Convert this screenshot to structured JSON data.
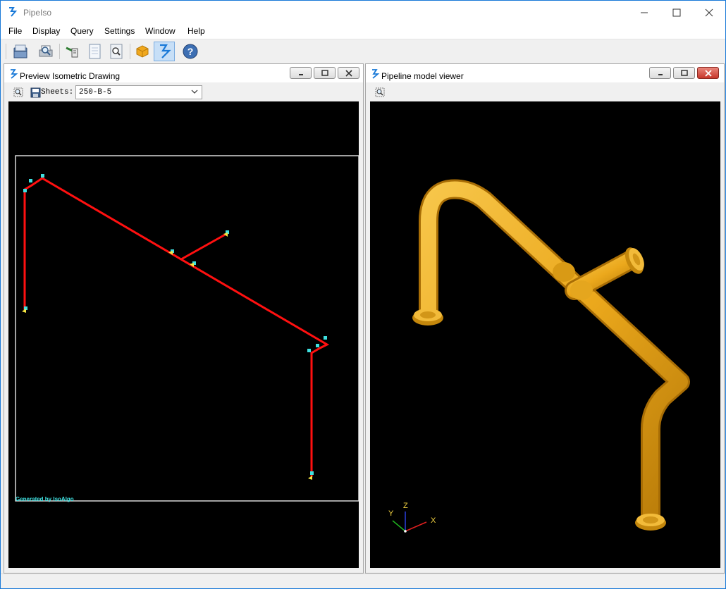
{
  "window": {
    "title": "PipeIso"
  },
  "menu": {
    "items": [
      "File",
      "Display",
      "Query",
      "Settings",
      "Window",
      "Help"
    ]
  },
  "toolbar": {
    "buttons": [
      {
        "icon": "open-folder-icon"
      },
      {
        "icon": "print-preview-icon"
      },
      {
        "icon": "pipe-tool-icon"
      },
      {
        "icon": "document-icon"
      },
      {
        "icon": "search-icon"
      },
      {
        "icon": "cube-icon"
      },
      {
        "icon": "pipeiso-logo-icon",
        "active": true
      },
      {
        "icon": "help-icon"
      }
    ]
  },
  "iso_panel": {
    "title": "Preview Isometric Drawing",
    "sheets_label": "Sheets:",
    "sheets_value": "250-B-5",
    "footer_text": "Generated by IsoAlgo"
  },
  "model_panel": {
    "title": "Pipeline model viewer",
    "axis_labels": {
      "x": "X",
      "y": "Y",
      "z": "Z"
    }
  },
  "colors": {
    "pipe_line": "#ff1010",
    "pipe_model": "#eba81c",
    "marker": "#3fe0e0",
    "accent": "#0b6fc9"
  }
}
